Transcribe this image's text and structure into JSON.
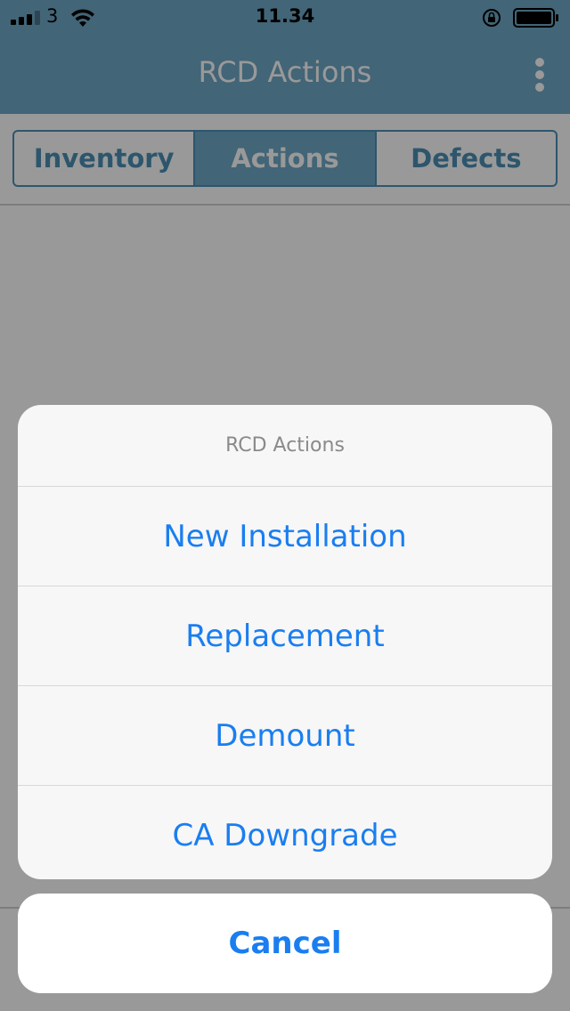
{
  "status_bar": {
    "carrier": "3",
    "time": "11.34",
    "signal_bars_filled": 3,
    "signal_bars_total": 4,
    "icons": [
      "signal-icon",
      "wifi-icon",
      "rotation-lock-icon",
      "battery-icon"
    ]
  },
  "header": {
    "title": "RCD Actions",
    "menu_icon": "more-vertical-icon"
  },
  "tabs": [
    {
      "label": "Inventory",
      "active": false
    },
    {
      "label": "Actions",
      "active": true
    },
    {
      "label": "Defects",
      "active": false
    }
  ],
  "action_sheet": {
    "title": "RCD Actions",
    "options": [
      {
        "label": "New Installation"
      },
      {
        "label": "Replacement"
      },
      {
        "label": "Demount"
      },
      {
        "label": "CA Downgrade"
      }
    ],
    "cancel_label": "Cancel"
  },
  "colors": {
    "header_bg": "#6fa8c7",
    "tab_accent": "#4b8fb4",
    "action_text": "#1a7ef0",
    "overlay": "rgba(0,0,0,0.4)"
  }
}
